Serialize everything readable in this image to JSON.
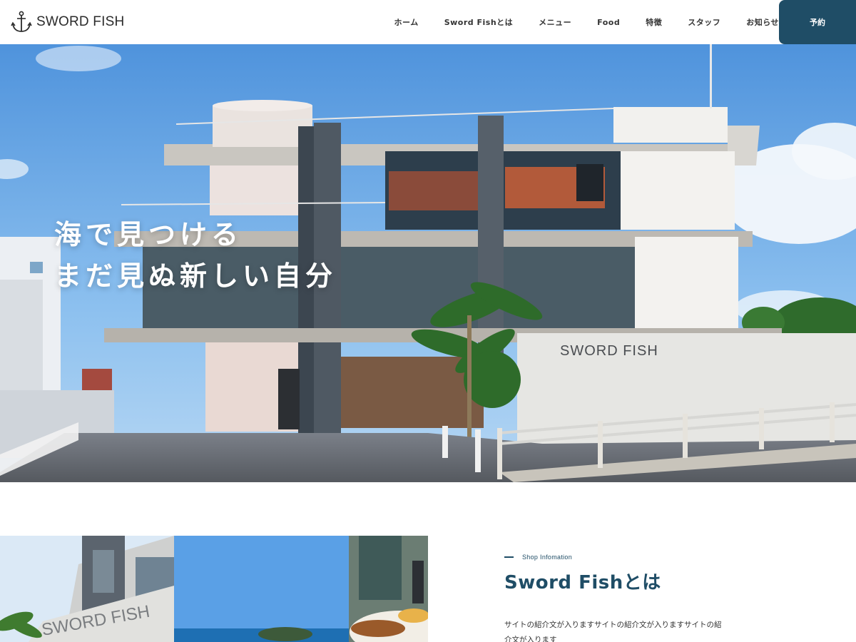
{
  "header": {
    "logo_text": "SWORD FISH",
    "nav": [
      "ホーム",
      "Sword Fishとは",
      "メニュー",
      "Food",
      "特徴",
      "スタッフ",
      "お知らせ"
    ],
    "reserve_label": "予約"
  },
  "hero": {
    "line1": "海で見つける",
    "line2": "まだ見ぬ新しい自分",
    "building_sign": "SWORD FISH"
  },
  "info": {
    "label": "Shop Infomation",
    "title": "Sword Fishとは",
    "body": "サイトの紹介文が入りますサイトの紹介文が入りますサイトの紹介文が入ります",
    "photo_sign": "SWORD FISH"
  },
  "colors": {
    "brand": "#1f4d66",
    "sky": "#6aa9e6"
  }
}
